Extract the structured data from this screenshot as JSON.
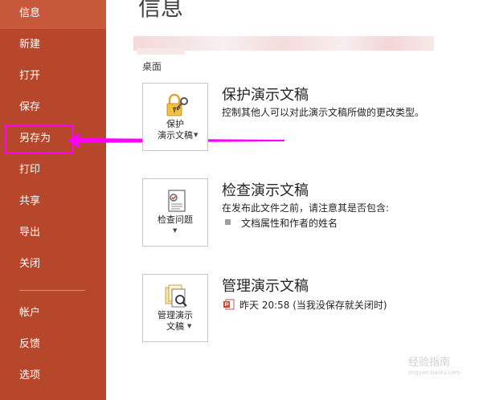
{
  "sidebar": {
    "items": [
      {
        "label": "信息"
      },
      {
        "label": "新建"
      },
      {
        "label": "打开"
      },
      {
        "label": "保存"
      },
      {
        "label": "另存为"
      },
      {
        "label": "打印"
      },
      {
        "label": "共享"
      },
      {
        "label": "导出"
      },
      {
        "label": "关闭"
      },
      {
        "label": "帐户"
      },
      {
        "label": "反馈"
      },
      {
        "label": "选项"
      }
    ]
  },
  "main": {
    "title": "信息",
    "location": "桌面",
    "sections": [
      {
        "button_label": "保护\n演示文稿",
        "heading": "保护演示文稿",
        "description": "控制其他人可以对此演示文稿所做的更改类型。"
      },
      {
        "button_label": "检查问题",
        "heading": "检查演示文稿",
        "description": "在发布此文件之前，请注意其是否包含:",
        "bullet": "文档属性和作者的姓名"
      },
      {
        "button_label": "管理演示\n文稿",
        "heading": "管理演示文稿",
        "version": "昨天 20:58 (当我没保存就关闭时)"
      }
    ]
  },
  "watermark": {
    "text": "经验指南",
    "sub": "jingyan.baidu.com"
  },
  "colors": {
    "sidebar_bg": "#b7472a",
    "annotation": "#ff00ff"
  }
}
